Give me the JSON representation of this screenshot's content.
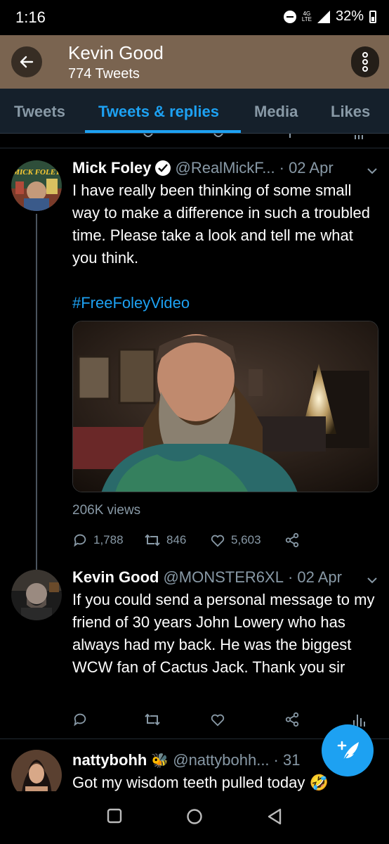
{
  "status": {
    "time": "1:16",
    "network": [
      "4G",
      "LTE"
    ],
    "battery": "32%"
  },
  "header": {
    "name": "Kevin Good",
    "tweet_count": "774 Tweets",
    "bg_color": "#7a6450"
  },
  "tabs": [
    {
      "label": "Tweets",
      "active": false
    },
    {
      "label": "Tweets & replies",
      "active": true
    },
    {
      "label": "Media",
      "active": false
    },
    {
      "label": "Likes",
      "active": false
    }
  ],
  "tweets": [
    {
      "name": "Mick Foley",
      "verified": true,
      "handle": "@RealMickF...",
      "date": "· 02 Apr",
      "text": "I have really been thinking of some small way to make a difference in such a troubled time. Please take a look and tell me what you think.",
      "hashtag": "#FreeFoleyVideo",
      "avatar_text": "MICK FOLEY",
      "views": "206K views",
      "replies": "1,788",
      "retweets": "846",
      "likes": "5,603"
    },
    {
      "name": "Kevin Good",
      "handle": "@MONSTER6XL",
      "date": "· 02 Apr",
      "text": "If you could send a personal message to my friend of 30 years John Lowery who has always had my back. He was the biggest WCW fan of Cactus Jack. Thank you sir"
    },
    {
      "name": "nattybohh",
      "emoji": "🐝",
      "handle": "@nattybohh...",
      "date": "· 31",
      "text": "Got my wisdom teeth pulled today 🤣"
    }
  ],
  "icons": {
    "back": "arrow-left-icon",
    "menu": "vertical-dots-icon",
    "compose": "quill-plus-icon",
    "reply": "reply-icon",
    "retweet": "retweet-icon",
    "like": "heart-icon",
    "share": "share-icon",
    "analytics": "analytics-icon"
  },
  "colors": {
    "accent": "#1da1f2",
    "muted": "#8899a6",
    "tab_bar": "#15202b"
  }
}
